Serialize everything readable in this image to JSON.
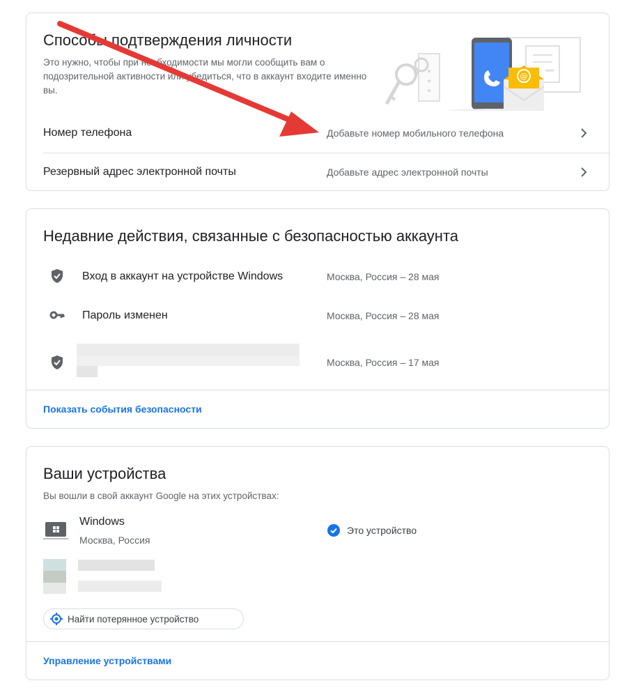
{
  "identity": {
    "title": "Способы подтверждения личности",
    "description": "Это нужно, чтобы при необходимости мы могли сообщить вам о подозрительной активности или убедиться, что в аккаунт входите именно вы.",
    "rows": [
      {
        "label": "Номер телефона",
        "value": "Добавьте номер мобильного телефона"
      },
      {
        "label": "Резервный адрес электронной почты",
        "value": "Добавьте адрес электронной почты"
      }
    ]
  },
  "security": {
    "title": "Недавние действия, связанные с безопасностью аккаунта",
    "events": [
      {
        "icon": "shield-icon",
        "label": "Вход в аккаунт на устройстве Windows",
        "value": "Москва, Россия – 28 мая"
      },
      {
        "icon": "key-icon",
        "label": "Пароль изменен",
        "value": "Москва, Россия – 28 мая"
      },
      {
        "icon": "shield-icon",
        "label": "",
        "value": "Москва, Россия – 17 мая"
      }
    ],
    "link": "Показать события безопасности"
  },
  "devices": {
    "title": "Ваши устройства",
    "description": "Вы вошли в свой аккаунт Google на этих устройствах:",
    "items": [
      {
        "icon": "laptop-icon",
        "name": "Windows",
        "location": "Москва, Россия",
        "badge": "Это устройство"
      }
    ],
    "find_button": "Найти потерянное устройство",
    "link": "Управление устройствами"
  },
  "colors": {
    "accent": "#1a73e8",
    "arrow": "#e53935",
    "text": "#202124",
    "secondary": "#5f6368"
  }
}
